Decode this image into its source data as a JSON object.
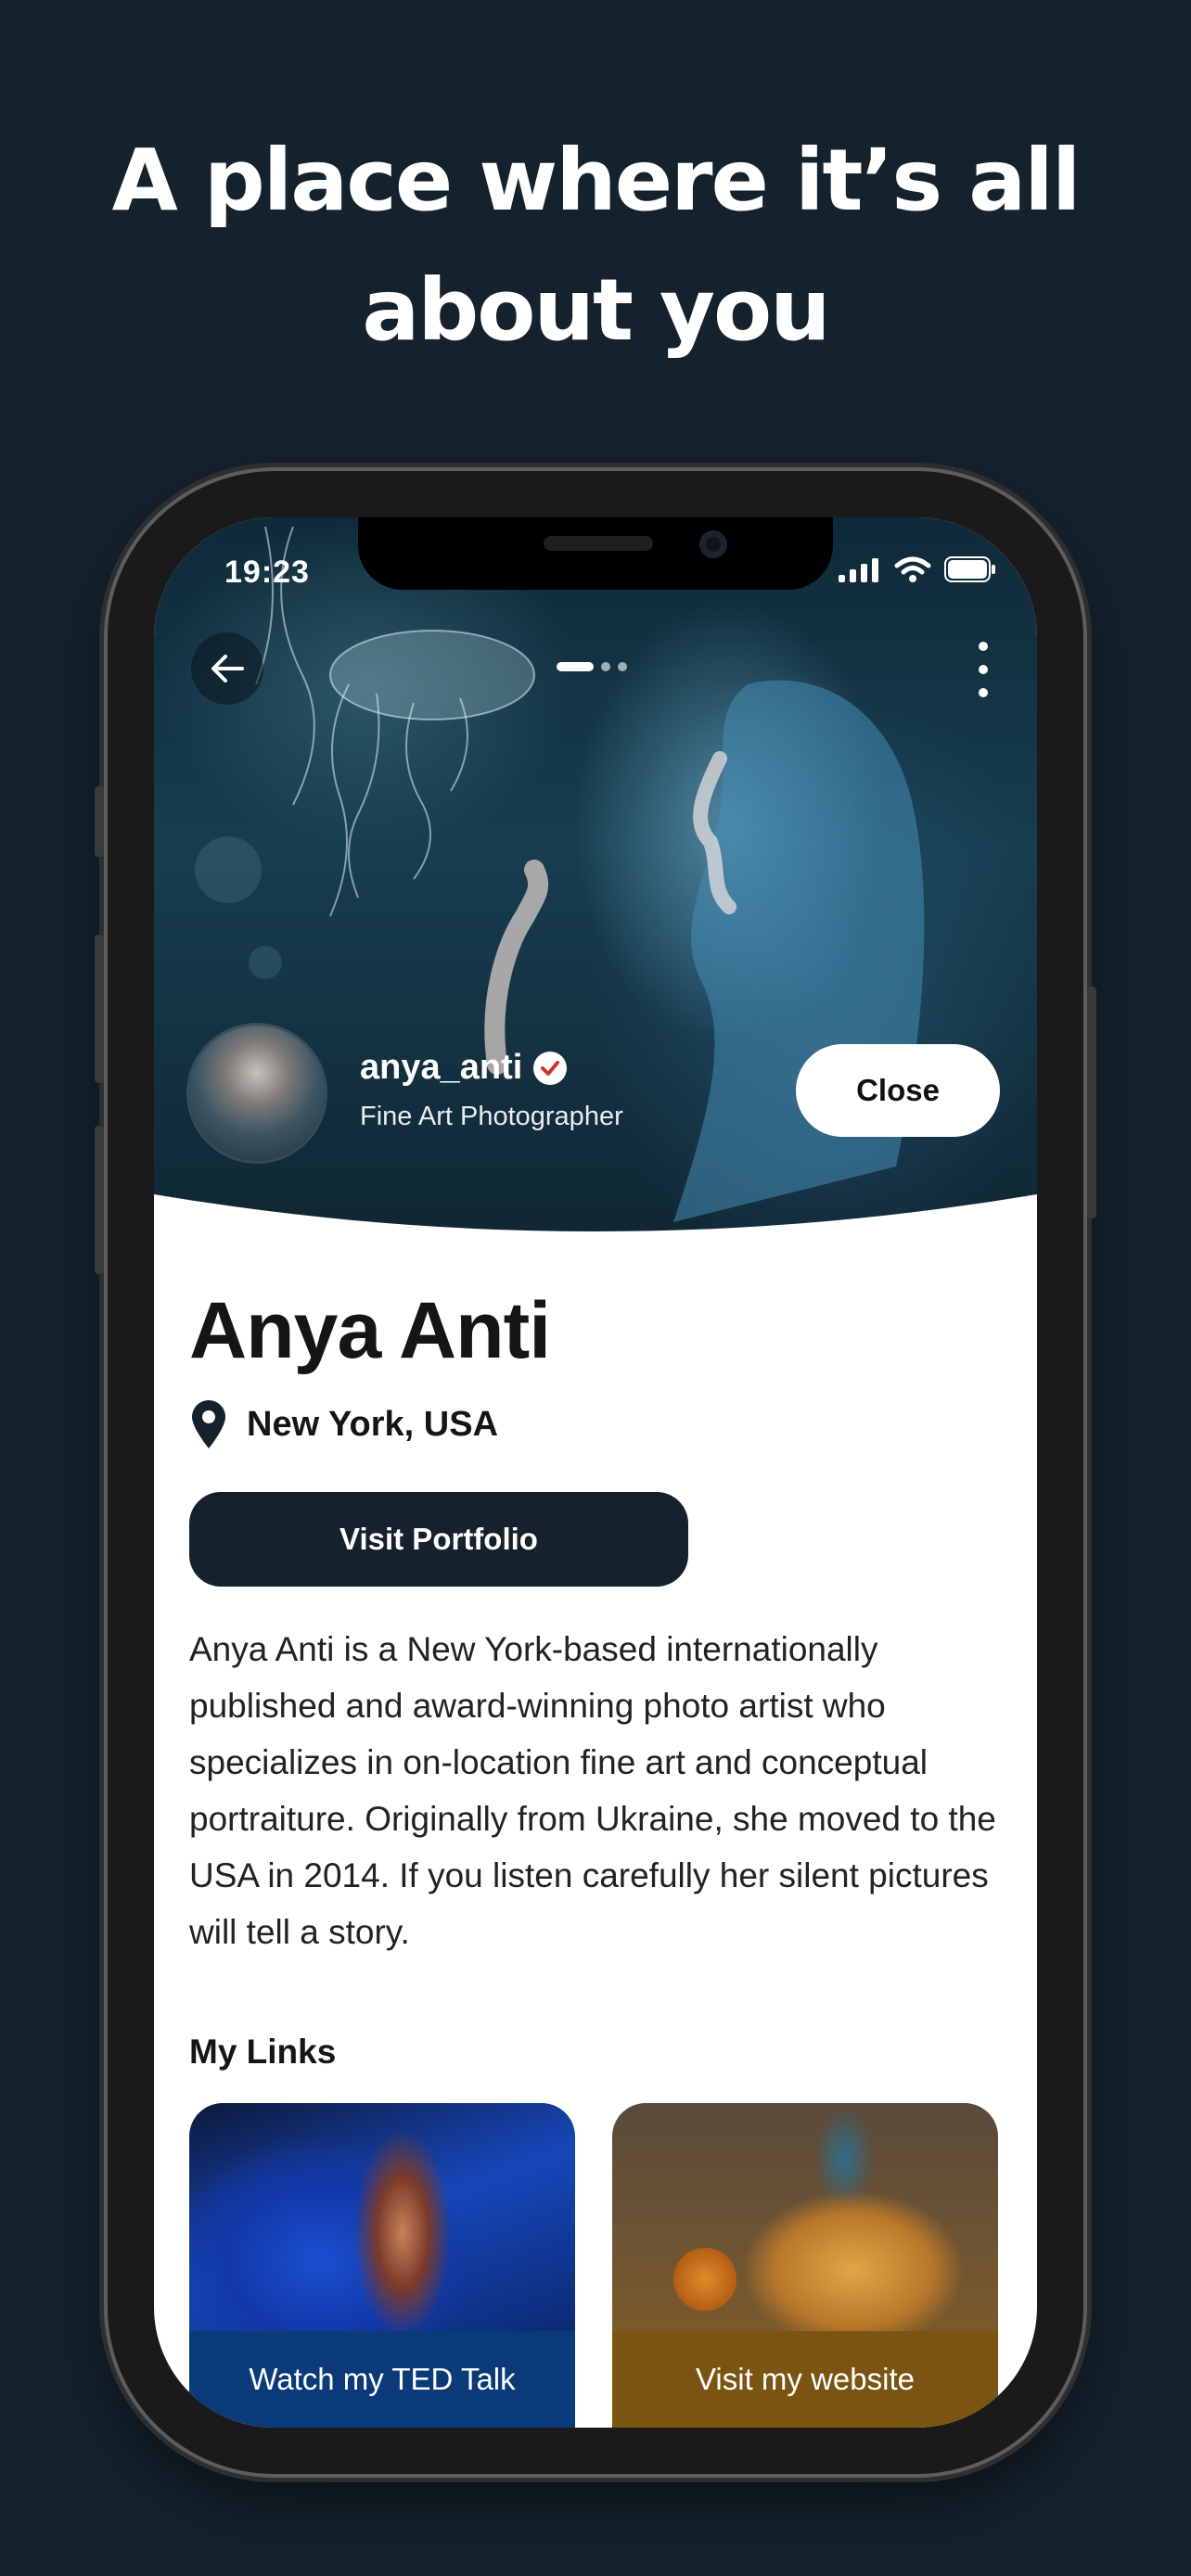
{
  "headline": {
    "line1": "A place where it’s all",
    "line2": "about you"
  },
  "statusbar": {
    "time": "19:23"
  },
  "profile": {
    "username": "anya_anti",
    "subtitle": "Fine Art Photographer",
    "close_label": "Close",
    "name": "Anya Anti",
    "location": "New York, USA",
    "portfolio_label": "Visit Portfolio",
    "bio": "Anya Anti is a New York-based internationally published and award-winning photo artist who specializes in on-location fine art and conceptual portraiture. Originally from Ukraine, she moved to the USA in 2014. If you listen carefully her silent pictures will tell a story."
  },
  "links": {
    "title": "My Links",
    "items": [
      {
        "label": "Watch my TED Talk",
        "color": "#0b3a78"
      },
      {
        "label": "Visit my website",
        "color": "#7a5410"
      }
    ]
  },
  "colors": {
    "background": "#14222d",
    "primary_button": "#15222d"
  }
}
